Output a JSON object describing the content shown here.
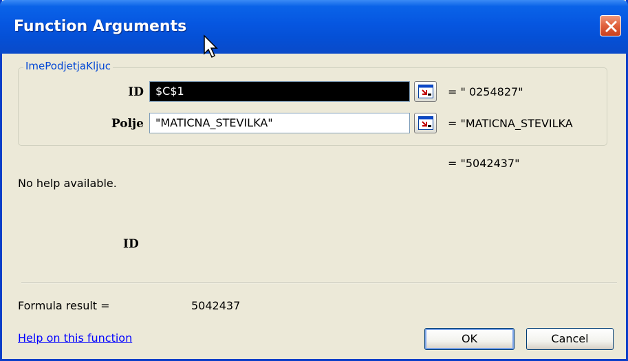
{
  "window": {
    "title": "Function Arguments"
  },
  "group": {
    "label": "ImePodjetjaKljuc"
  },
  "args": [
    {
      "label": "ID",
      "value": "$C$1",
      "result": "= \" 0254827\""
    },
    {
      "label": "Polje",
      "value": "\"MATICNA_STEVILKA\"",
      "result": "= \"MATICNA_STEVILKA"
    }
  ],
  "function_result": "= \"5042437\"",
  "help": {
    "description": "No help available.",
    "arg_help_label": "ID"
  },
  "formula": {
    "label": "Formula result =",
    "value": "5042437"
  },
  "help_link": "Help on this function",
  "buttons": {
    "ok": "OK",
    "cancel": "Cancel"
  },
  "colors": {
    "titlebar": "#0656e0",
    "dialog_bg": "#ece9d8",
    "group_label": "#0046d5",
    "link": "#0000ff"
  },
  "icons": {
    "close": "close-icon",
    "ref": "collapse-dialog-icon",
    "cursor": "mouse-pointer-icon"
  }
}
